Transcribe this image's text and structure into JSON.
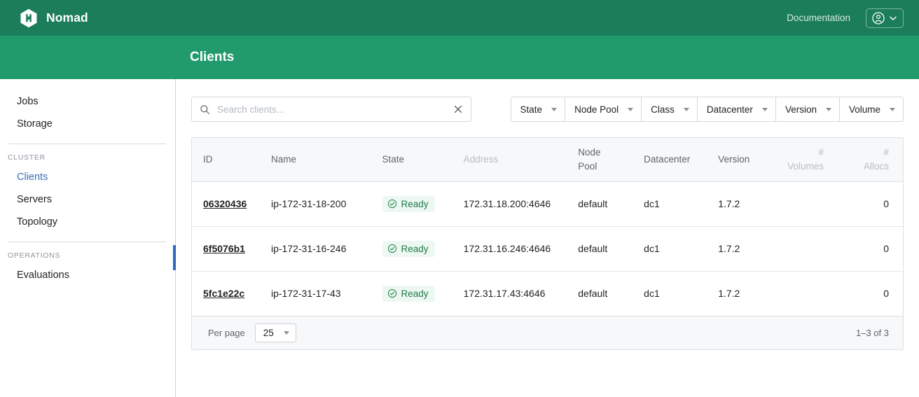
{
  "header": {
    "brand": "Nomad",
    "brand_icon": "nomad-hexagon-logo",
    "documentation_link": "Documentation",
    "profile_icon": "user-circle-icon",
    "profile_caret_icon": "chevron-down-icon",
    "page_title": "Clients"
  },
  "sidebar": {
    "top_items": [
      {
        "label": "Jobs",
        "active": false
      },
      {
        "label": "Storage",
        "active": false
      }
    ],
    "sections": [
      {
        "heading": "CLUSTER",
        "items": [
          {
            "label": "Clients",
            "active": true
          },
          {
            "label": "Servers",
            "active": false
          },
          {
            "label": "Topology",
            "active": false
          }
        ]
      },
      {
        "heading": "OPERATIONS",
        "items": [
          {
            "label": "Evaluations",
            "active": false
          }
        ]
      }
    ],
    "active_indicator_color": "#2a6ab8"
  },
  "search": {
    "placeholder": "Search clients...",
    "value": "",
    "icon": "search-icon",
    "clear_icon": "close-icon"
  },
  "filters": [
    {
      "label": "State"
    },
    {
      "label": "Node Pool"
    },
    {
      "label": "Class"
    },
    {
      "label": "Datacenter"
    },
    {
      "label": "Version"
    },
    {
      "label": "Volume"
    }
  ],
  "table": {
    "columns": [
      {
        "label": "ID",
        "muted": false,
        "align": "left"
      },
      {
        "label": "Name",
        "muted": false,
        "align": "left"
      },
      {
        "label": "State",
        "muted": false,
        "align": "left"
      },
      {
        "label": "Address",
        "muted": true,
        "align": "left"
      },
      {
        "label": "Node\nPool",
        "muted": false,
        "align": "left"
      },
      {
        "label": "Datacenter",
        "muted": false,
        "align": "left"
      },
      {
        "label": "Version",
        "muted": false,
        "align": "left"
      },
      {
        "label": "#\nVolumes",
        "muted": true,
        "align": "right"
      },
      {
        "label": "#\nAllocs",
        "muted": true,
        "align": "right"
      }
    ],
    "rows": [
      {
        "id": "06320436",
        "name": "ip-172-31-18-200",
        "state": "Ready",
        "state_icon": "check-circle-icon",
        "address": "172.31.18.200:4646",
        "node_pool": "default",
        "datacenter": "dc1",
        "version": "1.7.2",
        "volumes": "",
        "allocs": "0"
      },
      {
        "id": "6f5076b1",
        "name": "ip-172-31-16-246",
        "state": "Ready",
        "state_icon": "check-circle-icon",
        "address": "172.31.16.246:4646",
        "node_pool": "default",
        "datacenter": "dc1",
        "version": "1.7.2",
        "volumes": "",
        "allocs": "0"
      },
      {
        "id": "5fc1e22c",
        "name": "ip-172-31-17-43",
        "state": "Ready",
        "state_icon": "check-circle-icon",
        "address": "172.31.17.43:4646",
        "node_pool": "default",
        "datacenter": "dc1",
        "version": "1.7.2",
        "volumes": "",
        "allocs": "0"
      }
    ],
    "footer": {
      "per_page_label": "Per page",
      "per_page_value": "25",
      "per_page_caret_icon": "caret-down-icon",
      "range_text": "1–3 of 3"
    }
  },
  "colors": {
    "topbar_green": "#1c7d5b",
    "subnav_green": "#219a6c",
    "active_blue": "#2a6ab8",
    "ready_green": "#1e7a4b",
    "ready_badge_bg": "#eef8f2"
  }
}
